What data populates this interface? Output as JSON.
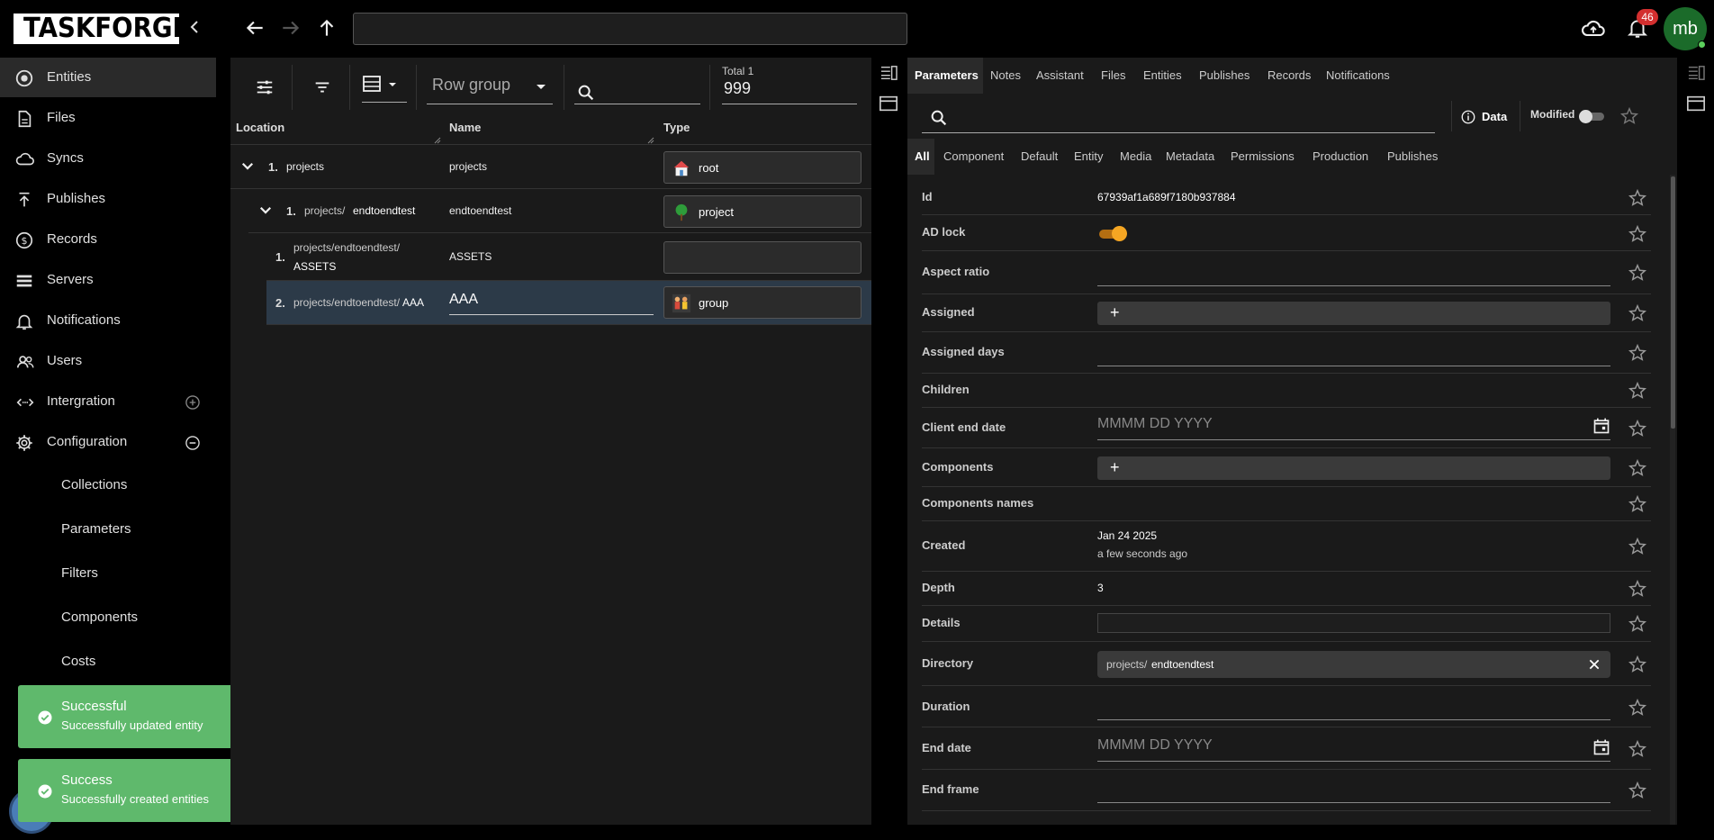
{
  "app": {
    "logo_text": "TASKFORGER"
  },
  "topbar": {
    "url": "",
    "notifications_count": "46",
    "avatar_initials": "mb"
  },
  "sidebar": {
    "items": [
      {
        "label": "Entities",
        "icon": "entities-icon",
        "active": true
      },
      {
        "label": "Files",
        "icon": "file-icon"
      },
      {
        "label": "Syncs",
        "icon": "cloud-sync-icon"
      },
      {
        "label": "Publishes",
        "icon": "publish-icon"
      },
      {
        "label": "Records",
        "icon": "dollar-icon"
      },
      {
        "label": "Servers",
        "icon": "servers-icon"
      },
      {
        "label": "Notifications",
        "icon": "bell-icon"
      },
      {
        "label": "Users",
        "icon": "users-icon"
      },
      {
        "label": "Intergration",
        "icon": "integration-icon"
      },
      {
        "label": "Configuration",
        "icon": "gear-icon"
      }
    ],
    "sub_items": [
      "Collections",
      "Parameters",
      "Filters",
      "Components",
      "Costs"
    ]
  },
  "toasts": [
    {
      "title": "Successful",
      "message": "Successfully updated entity"
    },
    {
      "title": "Success",
      "message": "Successfully created entities"
    }
  ],
  "table": {
    "row_group_placeholder": "Row group",
    "total_label": "Total 1",
    "total_value": "999",
    "columns": [
      "Location",
      "Name",
      "Type"
    ],
    "rows": [
      {
        "num": "1.",
        "location_prefix": "projects",
        "location_tail": "",
        "name": "projects",
        "type": "root"
      },
      {
        "num": "1.",
        "location_prefix": "projects/",
        "location_tail": "endtoendtest",
        "name": "endtoendtest",
        "type": "project"
      },
      {
        "num": "1.",
        "location_prefix": "projects/endtoendtest/",
        "location_tail": "ASSETS",
        "name": "ASSETS",
        "type": ""
      },
      {
        "num": "2.",
        "location_prefix": "projects/endtoendtest/",
        "location_tail": "AAA",
        "name": "AAA",
        "type": "group"
      }
    ]
  },
  "params": {
    "tabs": [
      "Parameters",
      "Notes",
      "Assistant",
      "Files",
      "Entities",
      "Publishes",
      "Records",
      "Notifications"
    ],
    "data_label": "Data",
    "modified_label": "Modified",
    "category_tabs": [
      "All",
      "Component",
      "Default",
      "Entity",
      "Media",
      "Metadata",
      "Permissions",
      "Production",
      "Publishes"
    ],
    "rows": {
      "id": {
        "label": "Id",
        "value": "67939af1a689f7180b937884"
      },
      "ad_lock": {
        "label": "AD lock",
        "on": true
      },
      "aspect_ratio": {
        "label": "Aspect ratio"
      },
      "assigned": {
        "label": "Assigned"
      },
      "assigned_days": {
        "label": "Assigned days"
      },
      "children": {
        "label": "Children"
      },
      "client_end_date": {
        "label": "Client end date",
        "placeholder": "MMMM DD YYYY"
      },
      "components": {
        "label": "Components"
      },
      "components_names": {
        "label": "Components names"
      },
      "created": {
        "label": "Created",
        "date": "Jan 24 2025",
        "relative": "a few seconds ago"
      },
      "depth": {
        "label": "Depth",
        "value": "3"
      },
      "details": {
        "label": "Details"
      },
      "directory": {
        "label": "Directory",
        "prefix": "projects/",
        "tail": "endtoendtest"
      },
      "duration": {
        "label": "Duration"
      },
      "end_date": {
        "label": "End date",
        "placeholder": "MMMM DD YYYY"
      },
      "end_frame": {
        "label": "End frame"
      }
    }
  },
  "colors": {
    "accent_orange": "#f5a623",
    "toast_green": "#5fb96c",
    "badge_red": "#d32f2f"
  }
}
